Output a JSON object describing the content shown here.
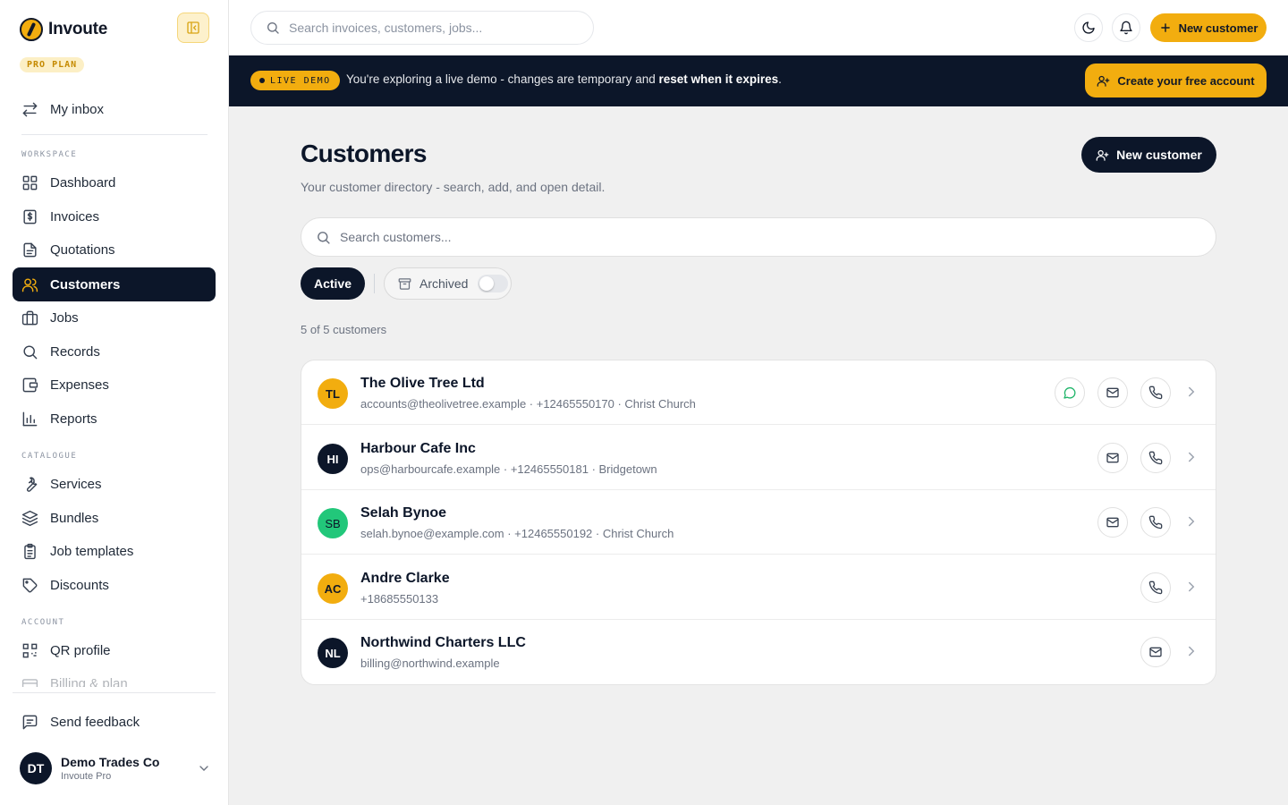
{
  "brand": {
    "name": "Invoute",
    "plan_badge": "PRO PLAN"
  },
  "sidebar": {
    "inbox": "My inbox",
    "sections": {
      "workspace": "WORKSPACE",
      "catalogue": "CATALOGUE",
      "account": "ACCOUNT"
    },
    "items": {
      "dashboard": "Dashboard",
      "invoices": "Invoices",
      "quotations": "Quotations",
      "customers": "Customers",
      "jobs": "Jobs",
      "records": "Records",
      "expenses": "Expenses",
      "reports": "Reports",
      "services": "Services",
      "bundles": "Bundles",
      "job_templates": "Job templates",
      "discounts": "Discounts",
      "qr_profile": "QR profile",
      "billing": "Billing & plan"
    },
    "feedback": "Send feedback",
    "user": {
      "initials": "DT",
      "name": "Demo Trades Co",
      "plan": "Invoute Pro"
    }
  },
  "topbar": {
    "search_placeholder": "Search invoices, customers, jobs...",
    "new_customer": "New customer"
  },
  "banner": {
    "pill": "LIVE DEMO",
    "text_pre": "You're exploring a live demo - changes are temporary and ",
    "text_bold": "reset when it expires",
    "text_post": ".",
    "cta": "Create your free account"
  },
  "main": {
    "title": "Customers",
    "subtitle": "Your customer directory - search, add, and open detail.",
    "new_customer": "New customer",
    "search_placeholder": "Search customers...",
    "tab_active": "Active",
    "tab_archived": "Archived",
    "count": "5 of 5 customers"
  },
  "customers": [
    {
      "initials": "TL",
      "name": "The Olive Tree Ltd",
      "meta": "accounts@theolivetree.example · +12465550170 · Christ Church"
    },
    {
      "initials": "HI",
      "name": "Harbour Cafe Inc",
      "meta": "ops@harbourcafe.example · +12465550181 · Bridgetown"
    },
    {
      "initials": "SB",
      "name": "Selah Bynoe",
      "meta": "selah.bynoe@example.com · +12465550192 · Christ Church"
    },
    {
      "initials": "AC",
      "name": "Andre Clarke",
      "meta": "+18685550133"
    },
    {
      "initials": "NL",
      "name": "Northwind Charters LLC",
      "meta": "billing@northwind.example"
    }
  ],
  "colors": {
    "accent": "#f2ad0f",
    "dark": "#0c1629",
    "green": "#22c77a",
    "whatsapp": "#20b56a"
  },
  "icons": {
    "whatsapp": "chat-icon",
    "email": "mail-icon",
    "phone": "phone-icon",
    "open": "chevron-right-icon"
  }
}
